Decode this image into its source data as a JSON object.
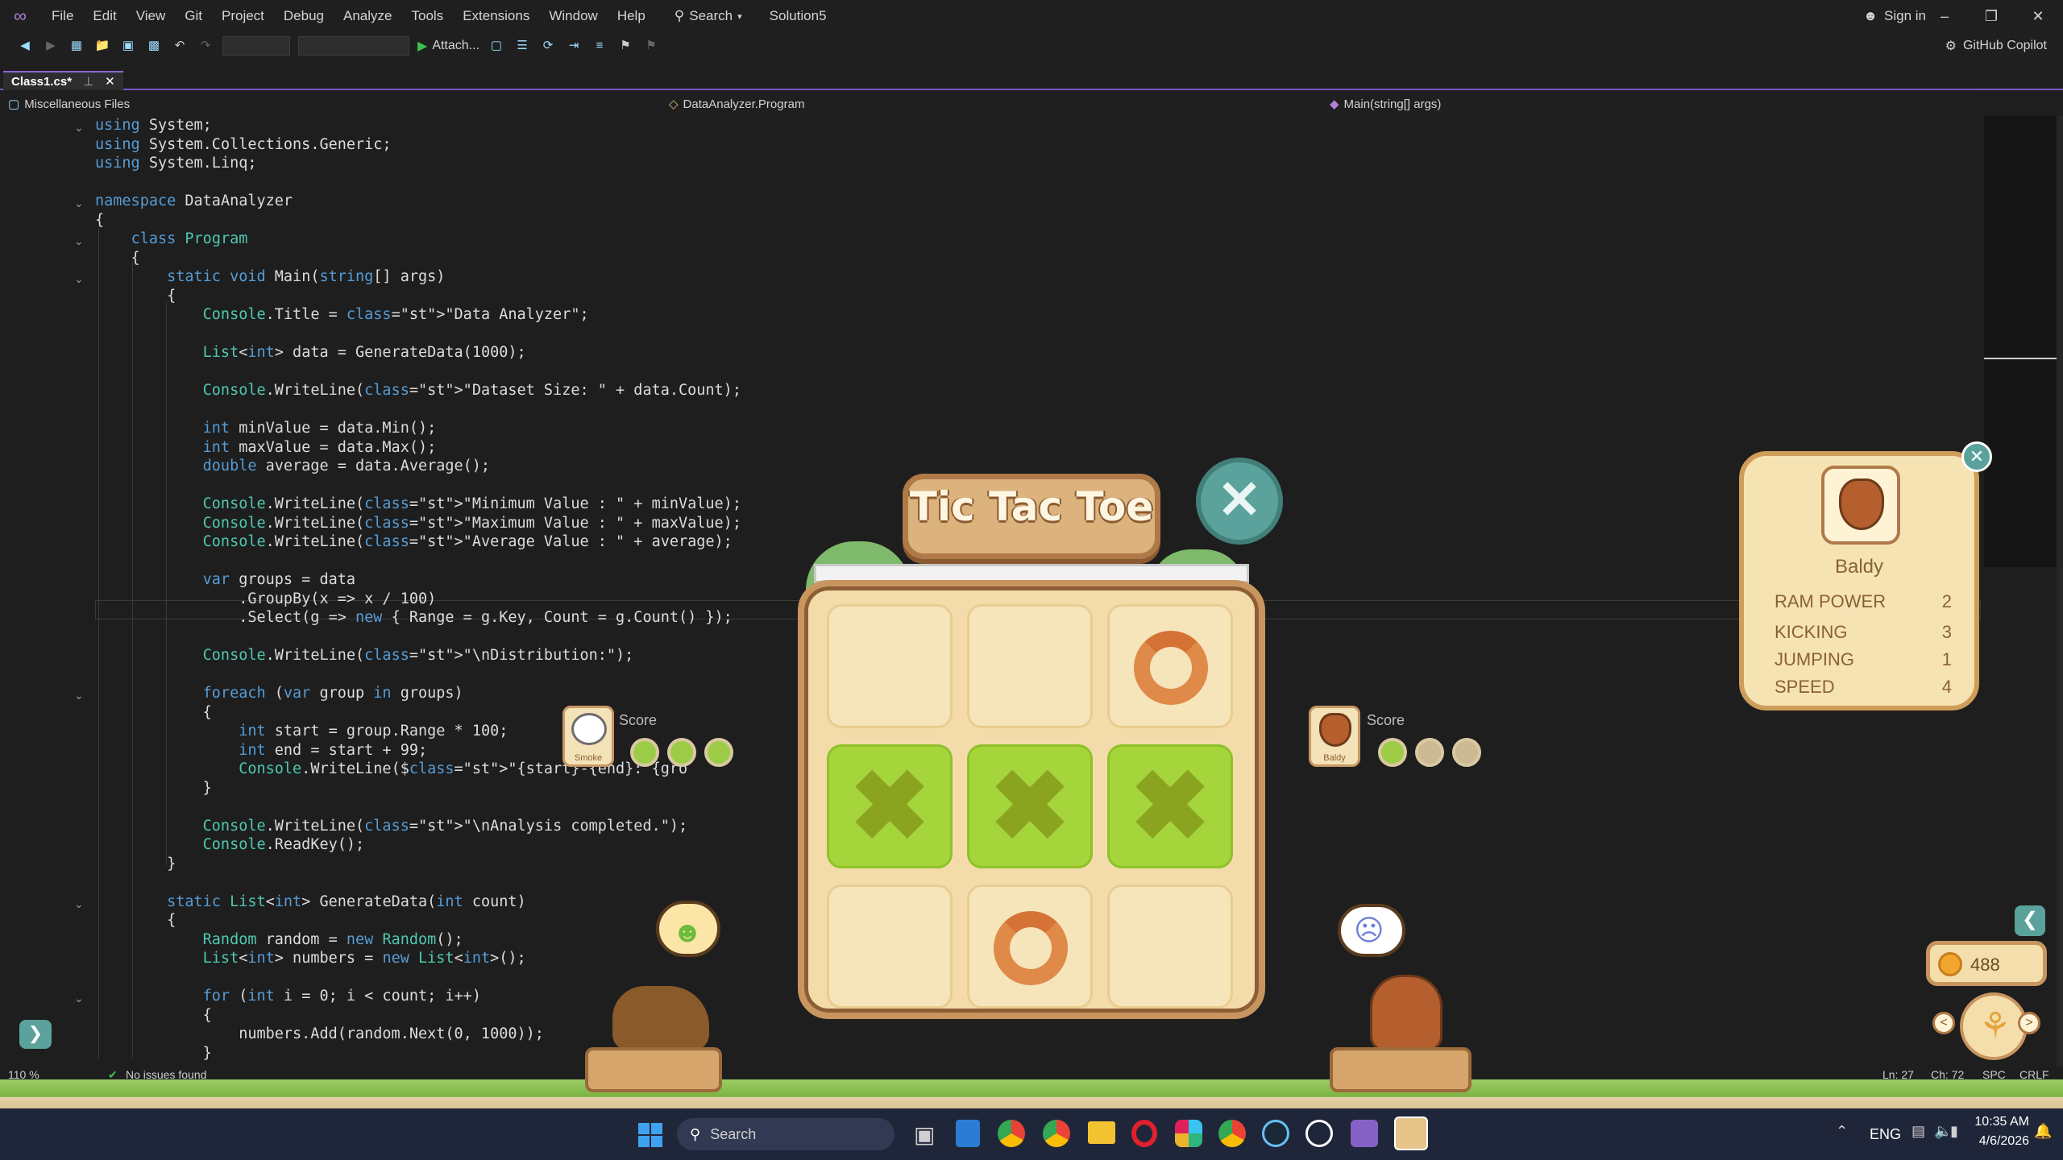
{
  "titlebar": {
    "menu": [
      "File",
      "Edit",
      "View",
      "Git",
      "Project",
      "Debug",
      "Analyze",
      "Tools",
      "Extensions",
      "Window",
      "Help"
    ],
    "search_label": "Search",
    "solution": "Solution5",
    "signin": "Sign in"
  },
  "toolbar": {
    "attach_label": "Attach...",
    "copilot_label": "GitHub Copilot"
  },
  "tab": {
    "label": "Class1.cs*"
  },
  "navbar": {
    "project": "Miscellaneous Files",
    "type": "DataAnalyzer.Program",
    "member": "Main(string[] args)"
  },
  "code_lines": [
    "using System;",
    "using System.Collections.Generic;",
    "using System.Linq;",
    "",
    "namespace DataAnalyzer",
    "{",
    "    class Program",
    "    {",
    "        static void Main(string[] args)",
    "        {",
    "            Console.Title = \"Data Analyzer\";",
    "",
    "            List<int> data = GenerateData(1000);",
    "",
    "            Console.WriteLine(\"Dataset Size: \" + data.Count);",
    "",
    "            int minValue = data.Min();",
    "            int maxValue = data.Max();",
    "            double average = data.Average();",
    "",
    "            Console.WriteLine(\"Minimum Value : \" + minValue);",
    "            Console.WriteLine(\"Maximum Value : \" + maxValue);",
    "            Console.WriteLine(\"Average Value : \" + average);",
    "",
    "            var groups = data",
    "                .GroupBy(x => x / 100)",
    "                .Select(g => new { Range = g.Key, Count = g.Count() });",
    "",
    "            Console.WriteLine(\"\\nDistribution:\");",
    "",
    "            foreach (var group in groups)",
    "            {",
    "                int start = group.Range * 100;",
    "                int end = start + 99;",
    "                Console.WriteLine($\"{start}-{end}: {gro",
    "            }",
    "",
    "            Console.WriteLine(\"\\nAnalysis completed.\");",
    "            Console.ReadKey();",
    "        }",
    "",
    "        static List<int> GenerateData(int count)",
    "        {",
    "            Random random = new Random();",
    "            List<int> numbers = new List<int>();",
    "",
    "            for (int i = 0; i < count; i++)",
    "            {",
    "                numbers.Add(random.Next(0, 1000));",
    "            }"
  ],
  "statusbar": {
    "zoom": "110 %",
    "issues": "No issues found",
    "line": "Ln: 27",
    "col": "Ch: 72",
    "enc": "SPC",
    "eol": "CRLF"
  },
  "game": {
    "title": "Tic Tac Toe",
    "board": [
      "",
      "",
      "O",
      "X",
      "X",
      "X",
      "",
      "O",
      ""
    ],
    "player_left": {
      "name": "Smoke",
      "score_label": "Score",
      "dots": [
        true,
        true,
        true
      ]
    },
    "player_right": {
      "name": "Baldy",
      "score_label": "Score",
      "dots": [
        true,
        false,
        false
      ]
    },
    "stats": {
      "name": "Baldy",
      "rows": [
        {
          "label": "RAM POWER",
          "value": "2"
        },
        {
          "label": "KICKING",
          "value": "3"
        },
        {
          "label": "JUMPING",
          "value": "1"
        },
        {
          "label": "SPEED",
          "value": "4"
        }
      ]
    },
    "coins": "488"
  },
  "taskbar": {
    "search": "Search",
    "lang": "ENG",
    "time": "10:35 AM",
    "date": "4/6/2026"
  }
}
